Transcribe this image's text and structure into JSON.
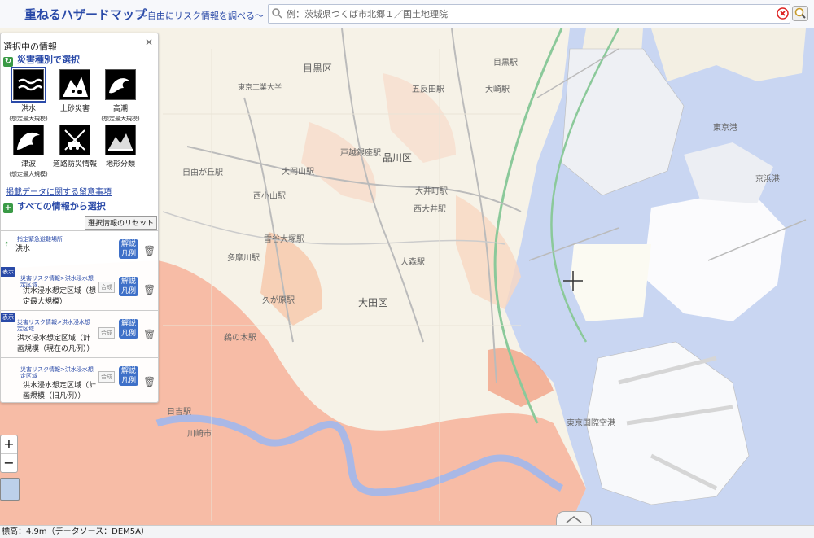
{
  "header": {
    "title": "重ねるハザードマップ",
    "subtitle": "〜自由にリスク情報を調べる〜",
    "search_placeholder": "例：茨城県つくば市北郷１／国土地理院"
  },
  "panel": {
    "title": "選択中の情報",
    "by_type_label": "災害種別で選択",
    "hazards": [
      {
        "label": "洪水",
        "sub": "(想定最大規模)"
      },
      {
        "label": "土砂災害",
        "sub": ""
      },
      {
        "label": "高潮",
        "sub": "(想定最大規模)"
      },
      {
        "label": "津波",
        "sub": "(想定最大規模)"
      },
      {
        "label": "道路防災情報",
        "sub": ""
      },
      {
        "label": "地形分類",
        "sub": ""
      }
    ],
    "note_link": "掲載データに関する留意事項",
    "all_info_label": "すべての情報から選択",
    "reset_label": "選択情報のリセット",
    "layers": [
      {
        "badge": "",
        "crumb": "指定緊急避難場所",
        "name": "洪水",
        "combine": "",
        "explain": "解説凡例"
      },
      {
        "badge": "表示",
        "crumb": "災害リスク情報>洪水浸水想定区域",
        "name": "洪水浸水想定区域（想定最大規模）",
        "combine": "合成",
        "explain": "解説凡例"
      },
      {
        "badge": "表示",
        "crumb": "災害リスク情報>洪水浸水想定区域",
        "name": "洪水浸水想定区域（計画規模（現在の凡例））",
        "combine": "合成",
        "explain": "解説凡例"
      },
      {
        "badge": "",
        "crumb": "災害リスク情報>洪水浸水想定区域",
        "name": "洪水浸水想定区域（計画規模（旧凡例））",
        "combine": "合成",
        "explain": "解説凡例"
      }
    ]
  },
  "map": {
    "labels": [
      "目黒区",
      "品川区",
      "大田区",
      "東京港",
      "大井町駅",
      "西大井駅",
      "大森駅",
      "多摩川駅",
      "久が原駅",
      "自由が丘駅",
      "五反田駅",
      "大崎駅",
      "東京国際空港",
      "京浜港",
      "目黒駅",
      "戸越銀座駅",
      "鵜の木駅",
      "西小山駅",
      "雪谷大塚駅",
      "大岡山駅",
      "日吉駅",
      "川崎市",
      "東京工業大学"
    ]
  },
  "zoom": {
    "in": "+",
    "out": "−"
  },
  "status": "標高：4.9m（データソース：DEM5A）",
  "colors": {
    "accent": "#2a4aa8",
    "sea": "#c9d6f2",
    "flood": "#f7b39a",
    "land": "#f6f2e7"
  }
}
